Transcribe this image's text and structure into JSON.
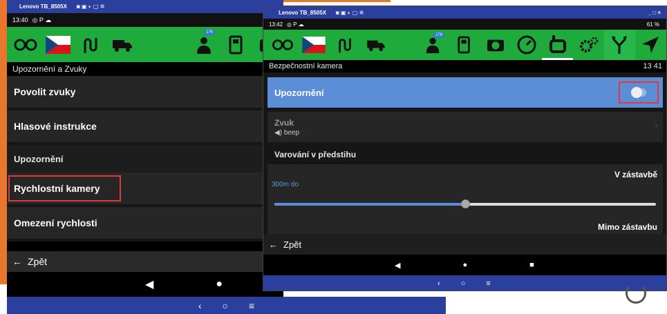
{
  "colors": {
    "accent_orange": "#e8772e",
    "toolbar_green": "#1faa3c",
    "title_blue": "#2b3f9e",
    "highlight_blue": "#5b8ed6",
    "red_box": "#e03a3a"
  },
  "left_window": {
    "title": "Lenovo TB_8505X",
    "status_time": "13:40",
    "section_title": "Upozornění a Zvuky",
    "rows": [
      "Povolit zvuky",
      "Hlasové instrukce"
    ],
    "subheader": "Upozornění",
    "highlighted_row": "Rychlostní kamery",
    "row_after": "Omezení rychlosti",
    "badge": "176",
    "back_label": "Zpět",
    "toolbar_icons": [
      "glasses-icon",
      "czech-flag-icon",
      "route-icon",
      "truck-icon",
      "driver-icon",
      "fuel-icon",
      "camera-icon"
    ]
  },
  "right_window": {
    "title": "Lenovo TB_8505X",
    "window_controls": "_ □ ×",
    "status_time": "13:42",
    "status_right": "61 %",
    "section_title": "Bezpečnostní kamera",
    "section_right": "13  41",
    "badge": "176",
    "toggle_label": "Upozornění",
    "toggle_on": false,
    "sound_title": "Zvuk",
    "sound_value": "beep",
    "warning_header": "Varování v předstihu",
    "city_label": "V zástavbě",
    "distance_value": "300m do",
    "slider_fraction": 0.5,
    "outside_label": "Mimo zástavbu",
    "back_label": "Zpět",
    "toolbar_icons": [
      "glasses-icon",
      "czech-flag-icon",
      "route-icon",
      "truck-icon",
      "driver-icon",
      "fuel-icon",
      "camera-icon",
      "speedometer-icon",
      "speed-camera-icon",
      "settings-icon",
      "fork-icon",
      "navigation-arrow-icon"
    ]
  },
  "nav": {
    "back": "‹",
    "home": "○",
    "menu": "≡",
    "tri": "◀",
    "dot": "●",
    "square": "■"
  }
}
